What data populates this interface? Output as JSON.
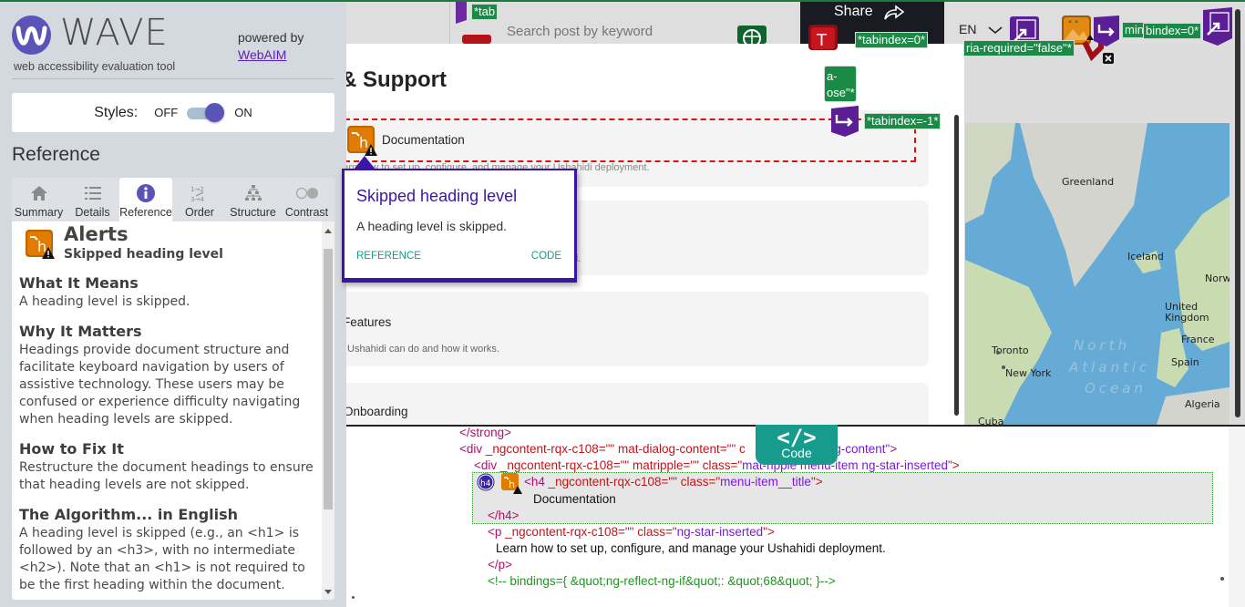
{
  "sidebar": {
    "brand": "WAVE",
    "subtitle": "web accessibility evaluation tool",
    "powered_by": "powered by",
    "webaim_link": "WebAIM",
    "styles_label": "Styles:",
    "styles_off": "OFF",
    "styles_on": "ON",
    "styles_enabled": true,
    "reference_heading": "Reference",
    "tabs": [
      {
        "label": "Summary",
        "icon": "home-icon",
        "active": false
      },
      {
        "label": "Details",
        "icon": "list-icon",
        "active": false
      },
      {
        "label": "Reference",
        "icon": "info-icon",
        "active": true
      },
      {
        "label": "Order",
        "icon": "order-icon",
        "active": false
      },
      {
        "label": "Structure",
        "icon": "structure-icon",
        "active": false
      },
      {
        "label": "Contrast",
        "icon": "contrast-icon",
        "active": false
      }
    ],
    "reference": {
      "category": "Alerts",
      "item": "Skipped heading level",
      "sections": [
        {
          "title": "What It Means",
          "text": "A heading level is skipped."
        },
        {
          "title": "Why It Matters",
          "text": "Headings provide document structure and facilitate keyboard navigation by users of assistive technology. These users may be confused or experience difficulty navigating when heading levels are skipped."
        },
        {
          "title": "How to Fix It",
          "text": "Restructure the document headings to ensure that heading levels are not skipped."
        },
        {
          "title": "The Algorithm... in English",
          "text": "A heading level is skipped (e.g., an <h1> is followed by an <h3>, with no intermediate <h2>). Note that an <h1> is not required to be the first heading within the document."
        }
      ]
    }
  },
  "page": {
    "search_placeholder": "Search post by keyword",
    "share_label": "Share",
    "language": "EN",
    "dialog_title": "& Support",
    "menu_items": [
      {
        "title": "Documentation",
        "desc": "Learn how to set up, configure, and manage your Ushahidi deployment."
      },
      {
        "title": "",
        "desc": "d."
      },
      {
        "title": "Features",
        "desc": "Ushahidi can do and how it works."
      },
      {
        "title": "Onboarding",
        "desc": ""
      }
    ],
    "wave_labels": {
      "tab_top": "*tab",
      "tabindex0_a": "*tabindex=0*",
      "aria_required": "ria-required=\"false\"*",
      "min_tabindex": "min*",
      "tabindex0_b": "bindex=0*",
      "close_chip_1": "a-",
      "close_chip_2": "ose\"*",
      "tabindex_neg": "*tabindex=-1*"
    },
    "map_labels": {
      "greenland": "Greenland",
      "iceland": "Iceland",
      "norway": "Norwa",
      "uk": "United Kingdom",
      "france": "France",
      "spain": "Spain",
      "algeria": "Algeria",
      "toronto": "Toronto",
      "new_york": "New York",
      "cuba": "Cuba",
      "ocean_1": "North",
      "ocean_2": "Atlantic",
      "ocean_3": "Ocean"
    }
  },
  "popup": {
    "title": "Skipped heading level",
    "body": "A heading level is skipped.",
    "reference_link": "REFERENCE",
    "code_link": "CODE"
  },
  "code": {
    "toggle_label": "Code",
    "toggle_glyph": "</>",
    "lines": {
      "l1": "</strong>",
      "l2_tag": "<div",
      "l2_attr": " _ngcontent-rqx-c108=\"\" mat-dialog-content=\"\" c",
      "l2_val_tail": "og-content\"",
      "l2_end": ">",
      "l3_tag": "<div",
      "l3_attr": " _ngcontent-rqx-c108=\"\" matripple=\"\" class=\"",
      "l3_val": "mat-ripple menu-item ng-star-inserted",
      "l3_end": "\">",
      "h4_badge": "h4",
      "l4_tag": "<h4",
      "l4_attr": " _ngcontent-rqx-c108=\"\" class=\"",
      "l4_val": "menu-item__title",
      "l4_end": "\">",
      "l5": "Documentation",
      "l6": "</h4>",
      "l7_tag": "<p",
      "l7_attr": " _ngcontent-rqx-c108=\"\" class=\"",
      "l7_val": "ng-star-inserted",
      "l7_end": "\">",
      "l8": "Learn how to set up, configure, and manage your Ushahidi deployment.",
      "l9": "</p>",
      "l10": "<!-- bindings={ &quot;ng-reflect-ng-if&quot;: &quot;68&quot; }-->"
    }
  },
  "colors": {
    "wave_purple": "#5b54b8",
    "popup_border": "#3b15a5",
    "link_teal": "#1a9a8a",
    "alert_orange": "#d97a00",
    "label_green": "#1b8a47"
  }
}
